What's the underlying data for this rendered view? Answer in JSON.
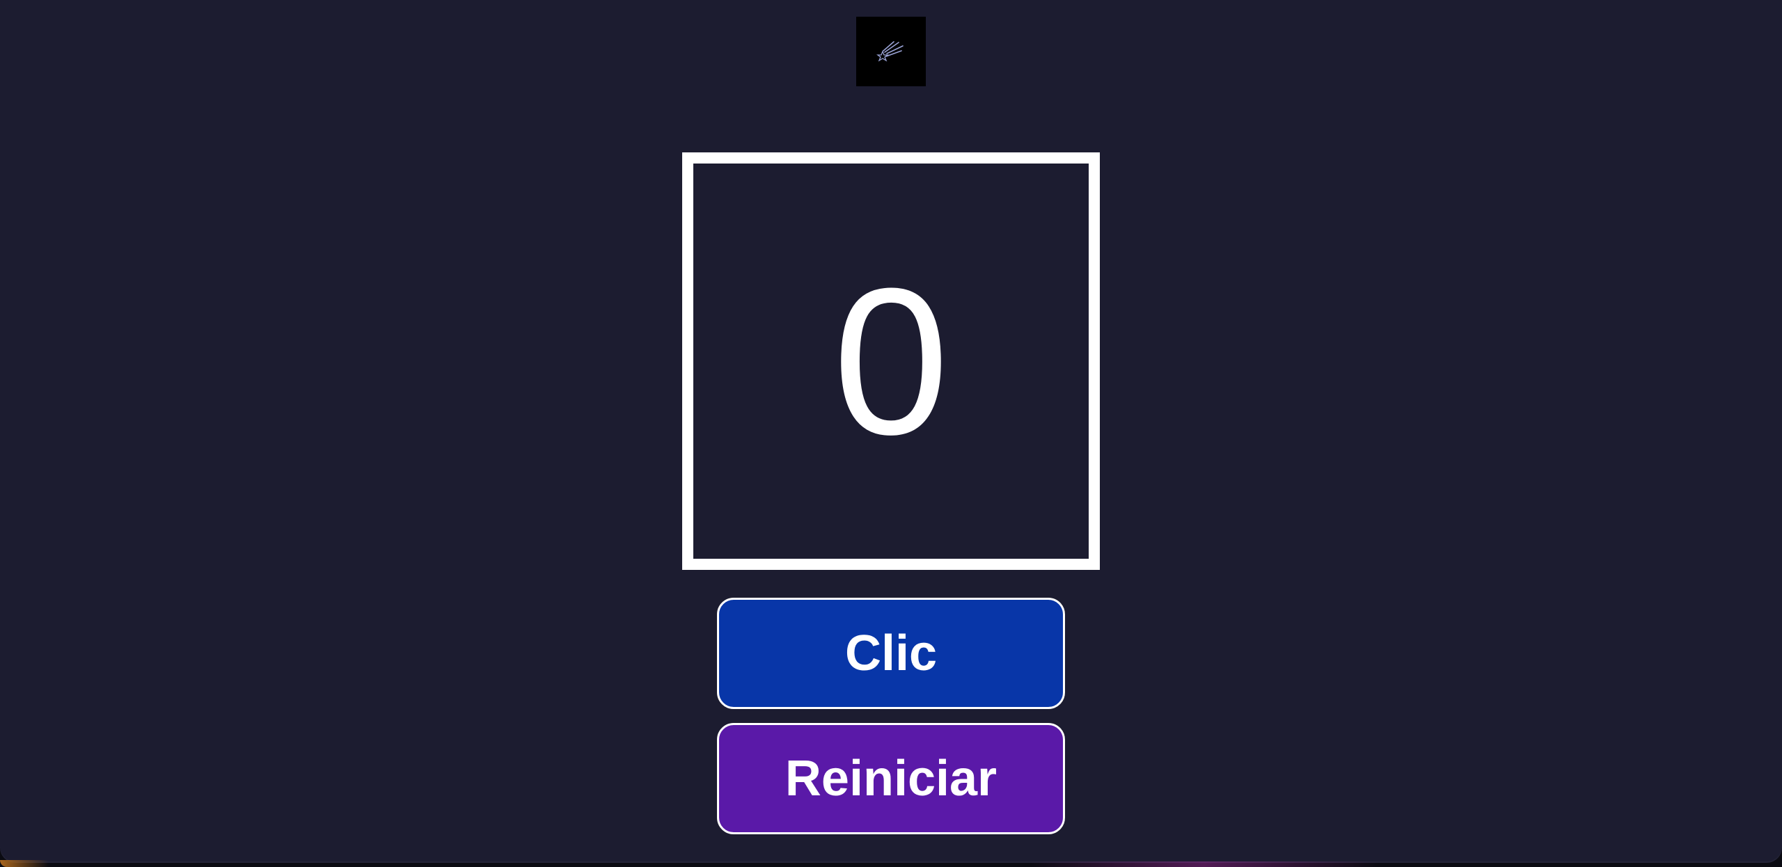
{
  "logo": {
    "icon": "shooting-star-icon",
    "colors": {
      "background": "#000000",
      "stroke": "#9aa3d6"
    }
  },
  "counter": {
    "value": "0"
  },
  "buttons": {
    "click_label": "Clic",
    "reset_label": "Reiniciar"
  },
  "colors": {
    "page_background": "#1c1c30",
    "click_button": "#0836a8",
    "reset_button": "#5a19a8",
    "border": "#ffffff"
  }
}
